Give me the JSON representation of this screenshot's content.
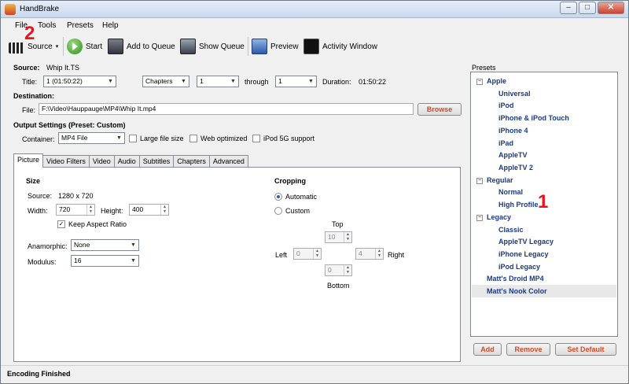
{
  "window": {
    "title": "HandBrake",
    "min": "‒",
    "max": "□",
    "close": "✕"
  },
  "menu": [
    "File",
    "Tools",
    "Presets",
    "Help"
  ],
  "toolbar": {
    "source": "Source",
    "start": "Start",
    "add_to_queue": "Add to Queue",
    "show_queue": "Show Queue",
    "preview": "Preview",
    "activity_window": "Activity Window"
  },
  "source": {
    "label": "Source:",
    "value": "Whip It.TS",
    "title_label": "Title:",
    "title_value": "1 (01:50:22)",
    "chapters_mode": "Chapters",
    "chapter_start": "1",
    "through_label": "through",
    "chapter_end": "1",
    "duration_label": "Duration:",
    "duration_value": "01:50:22"
  },
  "destination": {
    "label": "Destination:",
    "file_label": "File:",
    "file_value": "F:\\Video\\Hauppauge\\MP4\\Whip It.mp4",
    "browse": "Browse"
  },
  "output": {
    "label": "Output Settings (Preset: Custom)",
    "container_label": "Container:",
    "container_value": "MP4 File",
    "large_file": "Large file size",
    "web_optimized": "Web optimized",
    "ipod_5g": "iPod 5G support"
  },
  "tabs": [
    "Picture",
    "Video Filters",
    "Video",
    "Audio",
    "Subtitles",
    "Chapters",
    "Advanced"
  ],
  "picture": {
    "size_heading": "Size",
    "source_label": "Source:",
    "source_value": "1280 x 720",
    "width_label": "Width:",
    "width_value": "720",
    "height_label": "Height:",
    "height_value": "400",
    "keep_aspect": "Keep Aspect Ratio",
    "anamorphic_label": "Anamorphic:",
    "anamorphic_value": "None",
    "modulus_label": "Modulus:",
    "modulus_value": "16",
    "cropping_heading": "Cropping",
    "automatic": "Automatic",
    "custom": "Custom",
    "top_label": "Top",
    "top_value": "10",
    "left_label": "Left",
    "left_value": "0",
    "right_label": "Right",
    "right_value": "4",
    "bottom_label": "Bottom",
    "bottom_value": "0"
  },
  "presets": {
    "heading": "Presets",
    "groups": {
      "apple": "Apple",
      "regular": "Regular",
      "legacy": "Legacy"
    },
    "apple_items": [
      "Universal",
      "iPod",
      "iPhone & iPod Touch",
      "iPhone 4",
      "iPad",
      "AppleTV",
      "AppleTV 2"
    ],
    "regular_items": [
      "Normal",
      "High Profile"
    ],
    "legacy_items": [
      "Classic",
      "AppleTV Legacy",
      "iPhone Legacy",
      "iPod Legacy"
    ],
    "custom_items": [
      "Matt's Droid MP4",
      "Matt's Nook Color"
    ],
    "add": "Add",
    "remove": "Remove",
    "set_default": "Set Default"
  },
  "status": "Encoding Finished",
  "annotations": {
    "one": "1",
    "two": "2"
  },
  "colors": {
    "preset_text": "#1a3a86",
    "button_text": "#d44a2a",
    "annotation": "#e8141c"
  }
}
